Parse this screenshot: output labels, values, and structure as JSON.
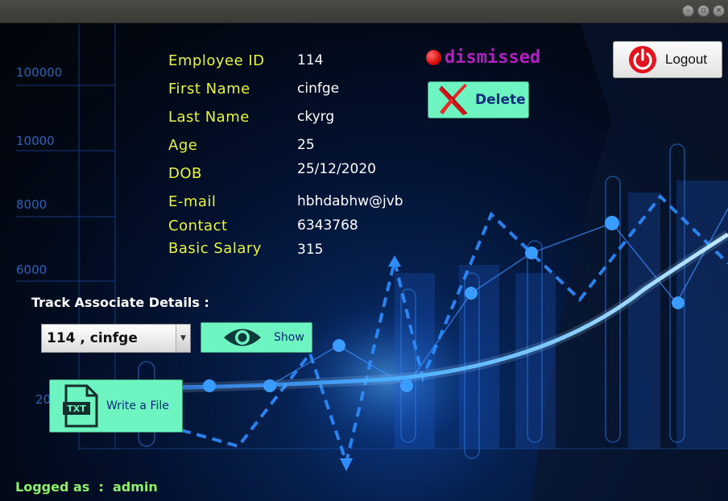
{
  "window": {
    "controls": {
      "minimize": "–",
      "maximize": "▫",
      "close": "×"
    }
  },
  "chart_background": {
    "y_axis_labels": [
      "100000",
      "10000",
      "8000",
      "6000",
      "20"
    ]
  },
  "employee": {
    "fields": [
      {
        "label": "Employee ID",
        "value": "114"
      },
      {
        "label": "First Name",
        "value": "cinfge"
      },
      {
        "label": "Last Name",
        "value": "ckyrg"
      },
      {
        "label": "Age",
        "value": "25"
      },
      {
        "label": "DOB",
        "value": "25/12/2020"
      },
      {
        "label": "E-mail",
        "value": "hbhdabhw@jvb"
      },
      {
        "label": "Contact",
        "value": "6343768"
      },
      {
        "label": "Basic Salary",
        "value": "315"
      }
    ]
  },
  "status": {
    "text": "dismissed",
    "dot_color": "#e01010",
    "text_color": "#b21fbf"
  },
  "actions": {
    "delete_label": "Delete",
    "logout_label": "Logout",
    "show_label": "Show",
    "write_file_label": "Write a File",
    "txt_badge": "TXT"
  },
  "track": {
    "label": "Track Associate Details :",
    "selected": "114 , cinfge"
  },
  "footer": {
    "logged_as_prefix": "Logged as  :  ",
    "user": "admin"
  },
  "colors": {
    "accent_mint": "#6df4c0",
    "label_yellow": "#e9f53a",
    "footer_green": "#8ff06a"
  }
}
